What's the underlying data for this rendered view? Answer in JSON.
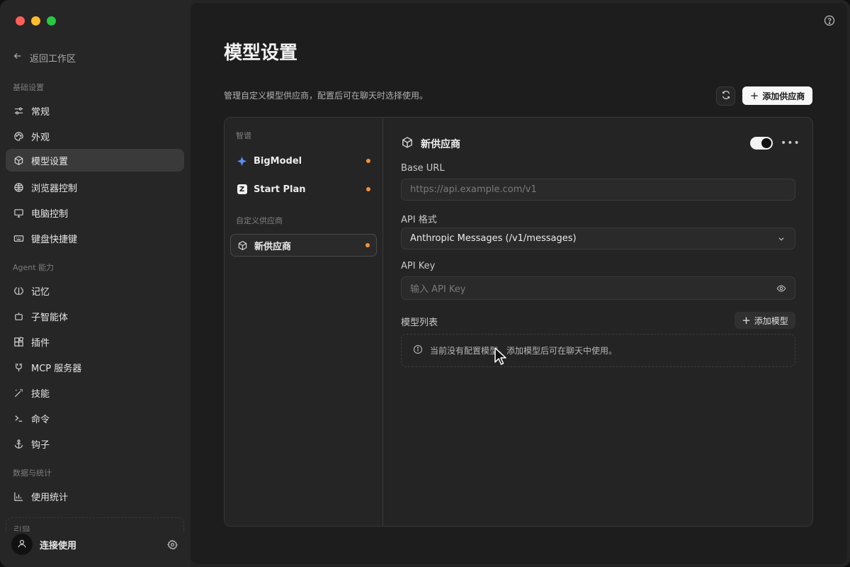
{
  "sidebar": {
    "back_label": "返回工作区",
    "sections": {
      "basic": "基础设置",
      "agent": "Agent 能力",
      "data": "数据与统计"
    },
    "items": [
      {
        "label": "常规",
        "icon": "sliders-icon"
      },
      {
        "label": "外观",
        "icon": "palette-icon"
      },
      {
        "label": "模型设置",
        "icon": "cube-icon",
        "active": true
      },
      {
        "label": "浏览器控制",
        "icon": "browser-icon"
      },
      {
        "label": "电脑控制",
        "icon": "monitor-icon"
      },
      {
        "label": "键盘快捷键",
        "icon": "keyboard-icon"
      },
      {
        "label": "记忆",
        "icon": "brain-icon"
      },
      {
        "label": "子智能体",
        "icon": "bot-icon"
      },
      {
        "label": "插件",
        "icon": "puzzle-icon"
      },
      {
        "label": "MCP 服务器",
        "icon": "plug-icon"
      },
      {
        "label": "技能",
        "icon": "wand-icon"
      },
      {
        "label": "命令",
        "icon": "terminal-icon"
      },
      {
        "label": "钩子",
        "icon": "anchor-icon"
      },
      {
        "label": "使用统计",
        "icon": "bar-chart-icon"
      }
    ],
    "bottom_partial": "引导",
    "user_label": "连接使用"
  },
  "main": {
    "title": "模型设置",
    "description": "管理自定义模型供应商，配置后可在聊天时选择使用。",
    "add_provider_label": "添加供应商",
    "providers_label": "智谱",
    "custom_label": "自定义供应商",
    "providers": [
      {
        "name": "BigModel",
        "status_color": "#f5923e"
      },
      {
        "name": "Start Plan",
        "status_color": "#f5923e"
      }
    ],
    "custom_providers": [
      {
        "name": "新供应商",
        "status_color": "#f5923e"
      }
    ],
    "detail": {
      "title": "新供应商",
      "enabled": true,
      "base_url_label": "Base URL",
      "base_url_placeholder": "https://api.example.com/v1",
      "api_format_label": "API 格式",
      "api_format_value": "Anthropic Messages (/v1/messages)",
      "api_key_label": "API Key",
      "api_key_placeholder": "输入 API Key",
      "models_label": "模型列表",
      "add_model_label": "添加模型",
      "empty_message": "当前没有配置模型，添加模型后可在聊天中使用。"
    }
  },
  "colors": {
    "accent_dot": "#f5923e",
    "bigmodel_logo": "#5b8cf6"
  }
}
